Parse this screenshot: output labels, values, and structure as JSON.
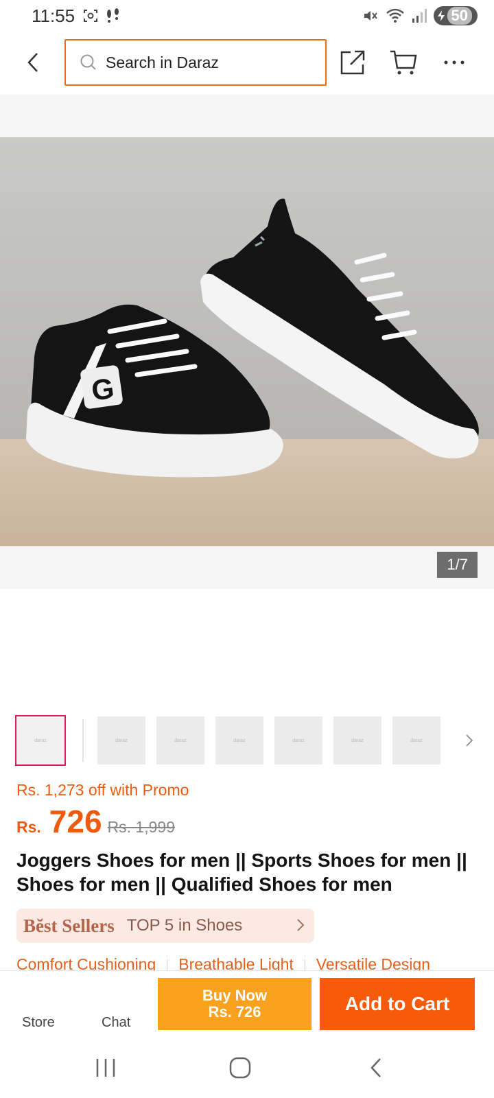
{
  "status_bar": {
    "time": "11:55",
    "battery": "50"
  },
  "header": {
    "search_placeholder": "Search in Daraz"
  },
  "gallery": {
    "counter": "1/7",
    "logo_letter": "G",
    "thumbnail_label": "daraz",
    "thumbnail_count": 7
  },
  "price": {
    "promo": "Rs. 1,273 off with Promo",
    "currency": "Rs.",
    "current": "726",
    "original": "Rs. 1,999"
  },
  "product": {
    "title": "Joggers Shoes for men || Sports Shoes for men || Shoes for men || Qualified Shoes for men"
  },
  "bestseller": {
    "badge": "Bĕst Sellers",
    "text": "TOP 5 in Shoes"
  },
  "features": [
    "Comfort Cushioning",
    "Breathable Light",
    "Versatile Design"
  ],
  "action_bar": {
    "store": "Store",
    "chat": "Chat",
    "buy_now_line1": "Buy Now",
    "buy_now_line2": "Rs. 726",
    "add_to_cart": "Add to Cart"
  },
  "colors": {
    "accent": "#f26a1b",
    "buy_now": "#faa21e",
    "add_to_cart": "#f75a0a",
    "price": "#f05a0e"
  }
}
